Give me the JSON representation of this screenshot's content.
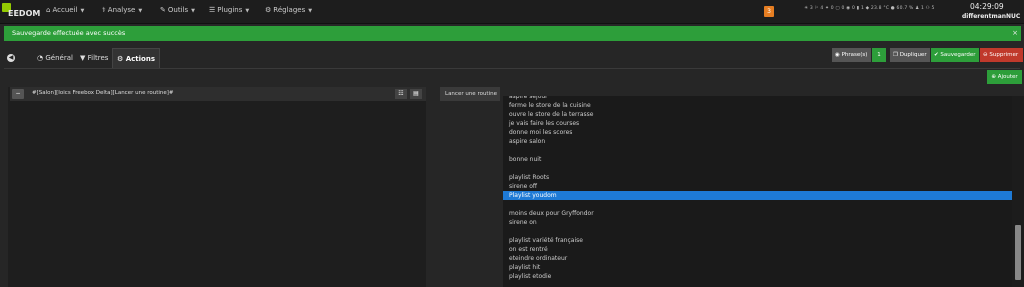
{
  "navbar": {
    "logo_text": "EEDOM",
    "items": [
      {
        "label": "Accueil",
        "icon": "home-icon"
      },
      {
        "label": "Analyse",
        "icon": "stethoscope-icon"
      },
      {
        "label": "Outils",
        "icon": "wrench-icon"
      },
      {
        "label": "Plugins",
        "icon": "tasks-icon"
      },
      {
        "label": "Réglages",
        "icon": "cogs-icon"
      }
    ],
    "message_count": "3",
    "status_text": "☀ 3  ⚐ 4  ✦ 0  ▢ 0  ◉ 0  ▮ 1  ◆ 23.8 °C  ● 60.7 %  ♟ 1    ⚇ 5",
    "time": "04:29:09",
    "hostname": "differentmanNUC"
  },
  "alert": {
    "text": "Sauvegarde effectuée avec succès",
    "close": "×",
    "color": "#2d9e3a"
  },
  "tabs": [
    {
      "label": "Général",
      "icon": "dashboard-icon"
    },
    {
      "label": "Filtres",
      "icon": "filter-icon"
    },
    {
      "label": "Actions",
      "icon": "cogs-icon"
    }
  ],
  "toolbar": {
    "phrases_label": "Phrase(s)",
    "phrases_count": "1",
    "duplicate_label": "Dupliquer",
    "save_label": "Sauvegarder",
    "delete_label": "Supprimer",
    "add_label": "Ajouter"
  },
  "action": {
    "command": "#[Salon][Ioics Freebox Delta][Lancer une routine]#",
    "routine_label": "Lancer une routine"
  },
  "routine_options": [
    "aspire séjour",
    "ferme le store de la cuisine",
    "ouvre le store de la terrasse",
    "je vais faire les courses",
    "donne moi les scores",
    "aspire salon",
    "",
    "bonne nuit",
    "",
    "playlist Roots",
    "sirene off",
    "Playlist youdom",
    "",
    "moins deux pour Gryffondor",
    "sirene on",
    "",
    "playlist variété française",
    "on est rentré",
    "eteindre ordinateur",
    "playlist hit",
    "playlist etodie"
  ],
  "selected_option": "Playlist youdom",
  "colors": {
    "accent_green": "#2d9e3a",
    "danger_red": "#c0392b",
    "selection_blue": "#1e7ad6",
    "badge_orange": "#e67e22"
  }
}
